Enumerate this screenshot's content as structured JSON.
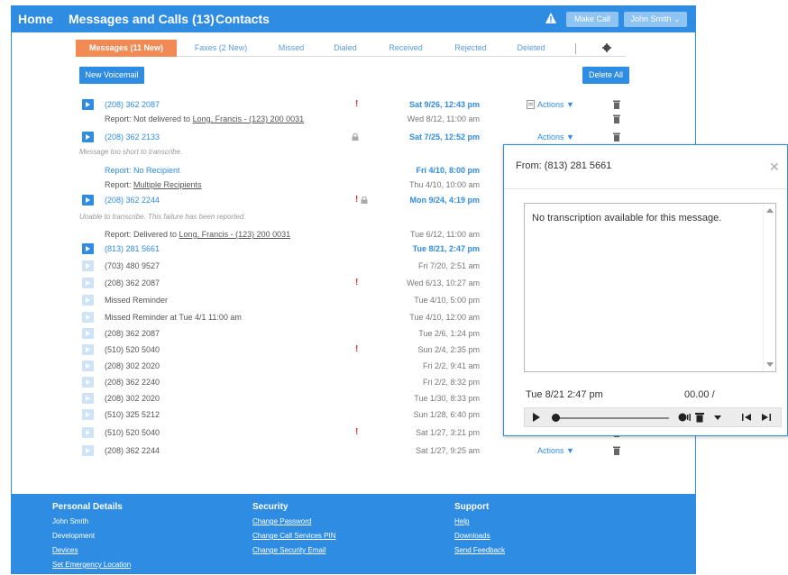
{
  "nav": {
    "home": "Home",
    "messages": "Messages and Calls (13)",
    "contacts": "Contacts",
    "make_call": "Make Call",
    "user": "John Smith ⌄"
  },
  "tabs": [
    "Messages (11 New)",
    "Faxes (2 New)",
    "Missed",
    "Dialed",
    "Received",
    "Rejected",
    "Deleted"
  ],
  "buttons": {
    "new_voicemail": "New Voicemail",
    "delete_all": "Delete All"
  },
  "rows": [
    {
      "who": "(208) 362 2087",
      "date": "Sat 9/26, 12:43 pm",
      "play": "on",
      "link": true,
      "excl": true,
      "bold": true,
      "actions": "Actions ▼",
      "fax": true
    },
    {
      "who": "Report: Not delivered to ",
      "who_u": "Long, Francis - (123) 200 0031",
      "date": "Wed 8/12, 11:00 am"
    },
    {
      "who": "(208) 362 2133",
      "date": "Sat 7/25, 12:52 pm",
      "play": "on",
      "link": true,
      "lock": true,
      "bold": true,
      "actions": "Actions ▼"
    },
    {
      "who": "Report: No Recipient",
      "date": "Fri 4/10, 8:00 pm",
      "link": true,
      "bold": true
    },
    {
      "who": "Report: ",
      "who_u": "Multiple Recipients",
      "date": "Thu 4/10, 10:00 am"
    },
    {
      "who": "(208) 362 2244",
      "date": "Mon 9/24, 4:19 pm",
      "play": "on",
      "link": true,
      "excl": true,
      "lock": true,
      "bold": true
    },
    {
      "who": "Report: Delivered to ",
      "who_u": "Long, Francis - (123) 200 0031",
      "date": "Tue 6/12, 11:00 am"
    },
    {
      "who": "(813) 281 5661",
      "date": "Tue 8/21, 2:47 pm",
      "play": "on",
      "link": true,
      "bold": true
    },
    {
      "who": "(703) 480 9527",
      "date": "Fri 7/20, 2:51 am",
      "play": "dim"
    },
    {
      "who": "(208) 362 2087",
      "date": "Wed 6/13, 10:27 am",
      "play": "dim",
      "excl": true
    },
    {
      "who": "Missed Reminder",
      "date": "Tue 4/10, 5:00 pm",
      "play": "dim"
    },
    {
      "who": "Missed Reminder at Tue 4/1 11:00 am",
      "date": "Tue 4/10, 12:00 am",
      "play": "dim"
    },
    {
      "who": "(208) 362 2087",
      "date": "Tue 2/6, 1:24 pm",
      "play": "dim"
    },
    {
      "who": "(510) 520 5040",
      "date": "Sun 2/4, 2:35 pm",
      "play": "dim",
      "excl": true
    },
    {
      "who": "(208) 302 2020",
      "date": "Fri 2/2, 9:41 am",
      "play": "dim"
    },
    {
      "who": "(208) 362 2240",
      "date": "Fri 2/2, 8:32 pm",
      "play": "dim"
    },
    {
      "who": "(208) 302 2020",
      "date": "Tue 1/30, 8:33 pm",
      "play": "dim"
    },
    {
      "who": "(510) 325 5212",
      "date": "Sun 1/28, 6:40 pm",
      "play": "dim"
    },
    {
      "who": "(510) 520 5040",
      "date": "Sat 1/27, 3:21 pm",
      "play": "dim",
      "excl": true,
      "actions": "Actions ▼"
    },
    {
      "who": "(208) 362 2244",
      "date": "Sat 1/27, 9:25 am",
      "play": "dim",
      "actions": "Actions ▼"
    }
  ],
  "notes": {
    "too_short": "Message too short to transcribe.",
    "failure": "Unable to transcribe. This failure has been reported."
  },
  "footer": {
    "personal": {
      "heading": "Personal Details",
      "items": [
        "John Smith",
        "Development",
        "Devices",
        "Set Emergency Location"
      ]
    },
    "security": {
      "heading": "Security",
      "items": [
        "Change Password",
        "Change Call Services PIN",
        "Change Security Email"
      ]
    },
    "support": {
      "heading": "Support",
      "items": [
        "Help",
        "Downloads",
        "Send Feedback"
      ]
    }
  },
  "popup": {
    "title": "From: (813) 281 5661",
    "close": "✕",
    "transcript": "No transcription available for this message.",
    "time": "Tue 8/21 2:47 pm",
    "duration": "00.00 /",
    "progress": 0
  },
  "colors": {
    "brand": "#2f8ce3",
    "active_tab": "#f18a55",
    "alert": "#e03030"
  }
}
